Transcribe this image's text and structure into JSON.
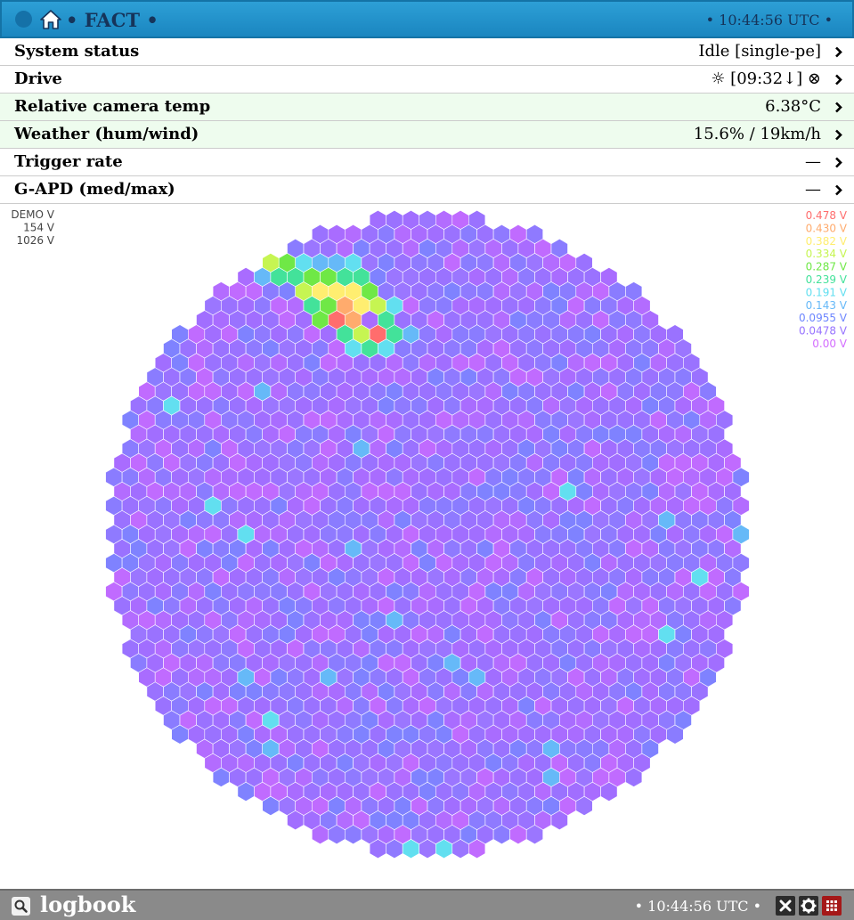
{
  "header": {
    "title": "• FACT •",
    "clock": "• 10:44:56 UTC •",
    "colors": {
      "bar": "#2596cf",
      "text": "#16345a"
    }
  },
  "status_rows": [
    {
      "label": "System status",
      "value": "Idle [single-pe]",
      "highlight": false
    },
    {
      "label": "Drive",
      "value": "☼ [09:32↓] ⊗",
      "highlight": false
    },
    {
      "label": "Relative camera temp",
      "value": "6.38°C",
      "highlight": true
    },
    {
      "label": "Weather (hum/wind)",
      "value": "15.6% / 19km/h",
      "highlight": true
    },
    {
      "label": "Trigger rate",
      "value": "—",
      "highlight": false
    },
    {
      "label": "G-APD (med/max)",
      "value": "—",
      "highlight": false
    }
  ],
  "camera": {
    "corner_labels": [
      "DEMO V",
      "154 V",
      "1026 V"
    ],
    "scale": [
      {
        "label": "0.478 V",
        "color": "#ff6d6d"
      },
      {
        "label": "0.430 V",
        "color": "#ffab6d"
      },
      {
        "label": "0.382 V",
        "color": "#ffee70"
      },
      {
        "label": "0.334 V",
        "color": "#c6f552"
      },
      {
        "label": "0.287 V",
        "color": "#6fe846"
      },
      {
        "label": "0.239 V",
        "color": "#43e29a"
      },
      {
        "label": "0.191 V",
        "color": "#62dff0"
      },
      {
        "label": "0.143 V",
        "color": "#66b9f8"
      },
      {
        "label": "0.0955 V",
        "color": "#6d86ff"
      },
      {
        "label": "0.0478 V",
        "color": "#9773ff"
      },
      {
        "label": "0.00 V",
        "color": "#d36dff"
      }
    ],
    "hotspot": {
      "description_values": [
        {
          "col": 5,
          "row": 4,
          "level": 0.47
        },
        {
          "col": 6,
          "row": 4,
          "level": 0.45
        },
        {
          "col": 7,
          "row": 5,
          "level": 0.46
        },
        {
          "col": 6,
          "row": 3,
          "level": 0.4
        },
        {
          "col": 5,
          "row": 3,
          "level": 0.42
        },
        {
          "col": 4,
          "row": 2,
          "level": 0.4
        },
        {
          "col": 5,
          "row": 2,
          "level": 0.36
        },
        {
          "col": 6,
          "row": 2,
          "level": 0.38
        },
        {
          "col": 3,
          "row": 2,
          "level": 0.34
        },
        {
          "col": 4,
          "row": 1,
          "level": 0.3
        },
        {
          "col": 3,
          "row": 1,
          "level": 0.28
        },
        {
          "col": 2,
          "row": 0,
          "level": 0.3
        },
        {
          "col": 1,
          "row": 0,
          "level": 0.32
        },
        {
          "col": 2,
          "row": 1,
          "level": 0.26
        },
        {
          "col": 1,
          "row": 1,
          "level": 0.24
        },
        {
          "col": 5,
          "row": 1,
          "level": 0.25
        },
        {
          "col": 6,
          "row": 1,
          "level": 0.22
        },
        {
          "col": 7,
          "row": 2,
          "level": 0.3
        },
        {
          "col": 7,
          "row": 3,
          "level": 0.32
        },
        {
          "col": 8,
          "row": 4,
          "level": 0.26
        },
        {
          "col": 8,
          "row": 5,
          "level": 0.22
        },
        {
          "col": 7,
          "row": 6,
          "level": 0.24
        },
        {
          "col": 4,
          "row": 3,
          "level": 0.28
        },
        {
          "col": 4,
          "row": 4,
          "level": 0.3
        },
        {
          "col": 6,
          "row": 5,
          "level": 0.34
        },
        {
          "col": 5,
          "row": 5,
          "level": 0.26
        },
        {
          "col": 3,
          "row": 3,
          "level": 0.22
        },
        {
          "col": 0,
          "row": 0,
          "level": 0.18
        },
        {
          "col": 0,
          "row": 1,
          "level": 0.16
        },
        {
          "col": 3,
          "row": 0,
          "level": 0.2
        },
        {
          "col": 4,
          "row": 0,
          "level": 0.16
        },
        {
          "col": 5,
          "row": 0,
          "level": 0.14
        },
        {
          "col": 6,
          "row": 0,
          "level": 0.18
        },
        {
          "col": 8,
          "row": 3,
          "level": 0.18
        },
        {
          "col": 9,
          "row": 5,
          "level": 0.16
        },
        {
          "col": 6,
          "row": 6,
          "level": 0.2
        },
        {
          "col": 8,
          "row": 6,
          "level": 0.21
        }
      ]
    }
  },
  "footer": {
    "title": "logbook",
    "clock": "• 10:44:56 UTC •"
  }
}
